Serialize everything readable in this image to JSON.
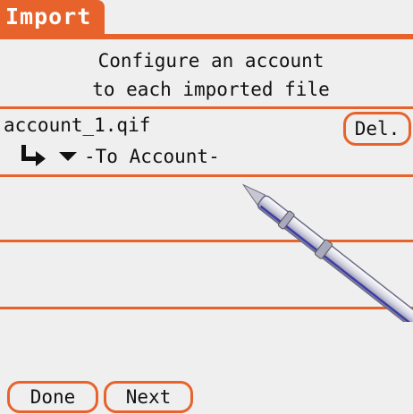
{
  "header": {
    "title": "Import"
  },
  "instruction": {
    "line1": "Configure an account",
    "line2": "to each imported file"
  },
  "file": {
    "name": "account_1.qif",
    "delete_label": "Del.",
    "account_placeholder": "-To Account-"
  },
  "footer": {
    "done_label": "Done",
    "next_label": "Next"
  },
  "colors": {
    "accent": "#e8632c",
    "background": "#efefef"
  },
  "icons": [
    "arrow-down-right-icon",
    "dropdown-triangle-icon",
    "stylus-icon"
  ]
}
